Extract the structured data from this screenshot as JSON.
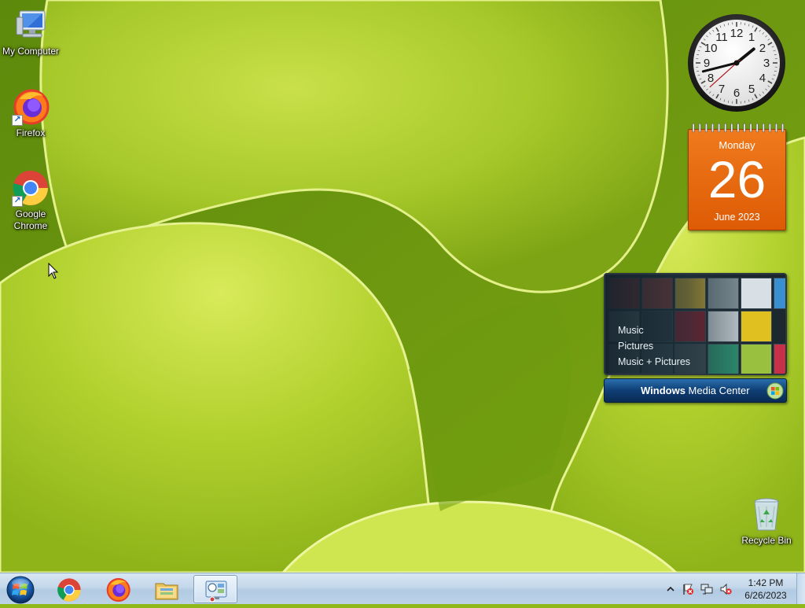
{
  "desktop": {
    "icons": [
      {
        "label": "My Computer",
        "icon": "computer-icon"
      },
      {
        "label": "Firefox",
        "icon": "firefox-icon"
      },
      {
        "label": "Google Chrome",
        "icon": "chrome-icon"
      },
      {
        "label": "Recycle Bin",
        "icon": "recycle-bin-icon"
      }
    ]
  },
  "gadgets": {
    "clock": {
      "hour": 1,
      "minute": 42,
      "second": 38
    },
    "calendar": {
      "day_name": "Monday",
      "day": "26",
      "month_year": "June 2023"
    },
    "media_center": {
      "items": [
        "Music",
        "Pictures",
        "Music + Pictures"
      ],
      "brand_bold": "Windows",
      "brand_rest": " Media Center"
    }
  },
  "taskbar": {
    "start": "start-orb-icon",
    "pinned": [
      {
        "name": "Google Chrome",
        "icon": "chrome-icon",
        "active": false
      },
      {
        "name": "Firefox",
        "icon": "firefox-icon",
        "active": false
      },
      {
        "name": "Windows Explorer",
        "icon": "folder-icon",
        "active": false
      },
      {
        "name": "Desktop Gadgets",
        "icon": "gadgets-icon",
        "active": true
      }
    ],
    "tray": {
      "time": "1:42 PM",
      "date": "6/26/2023",
      "icons": [
        "show-hidden-icon",
        "action-center-flag-icon",
        "network-icon",
        "volume-muted-icon"
      ]
    }
  },
  "colors": {
    "calendar_orange": "#e8690f",
    "taskbar_blue": "#c3d7ea",
    "wallpaper_green": "#8fb818"
  }
}
